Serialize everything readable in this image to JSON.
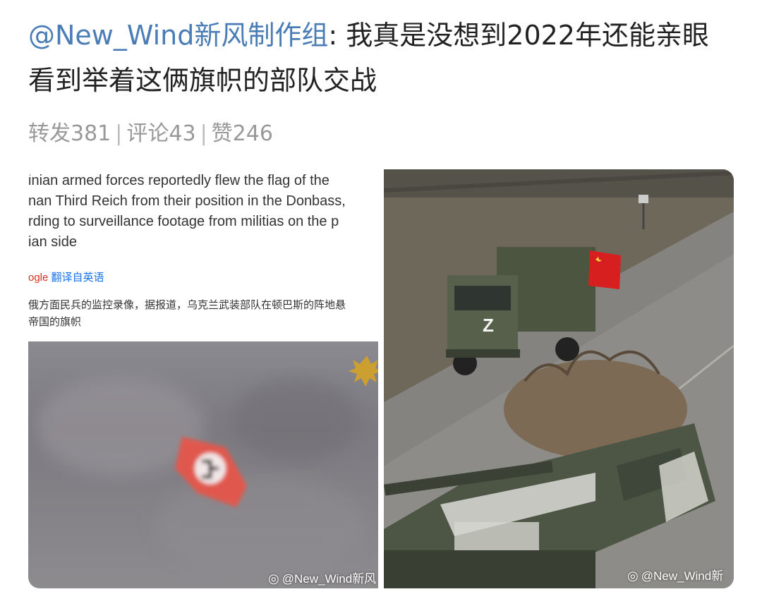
{
  "post": {
    "username": "@New_Wind新风制作组",
    "separator": ": ",
    "text": "我真是没想到2022年还能亲眼看到举着这俩旗帜的部队交战"
  },
  "stats": {
    "reposts": "转发381",
    "comments": "评论43",
    "likes": "赞246",
    "divider": "|"
  },
  "left_image": {
    "english_lines": "inian armed forces reportedly flew the flag of the\nnan Third Reich from their position in the Donbass,\nrding to surveillance footage from militias on the p\nian side",
    "google_prefix": "ogle",
    "translate_label": "翻译自英语",
    "chinese_lines": "俄方面民兵的监控录像，据报道，乌克兰武装部队在顿巴斯的阵地悬\n帝国的旗帜",
    "watermark": "@New_Wind新风"
  },
  "right_image": {
    "vehicle_mark": "Z",
    "watermark": "@New_Wind新"
  },
  "colors": {
    "username": "#4a7db5",
    "text": "#222222",
    "stats": "#999999",
    "flag_red": "#d71f1f"
  }
}
